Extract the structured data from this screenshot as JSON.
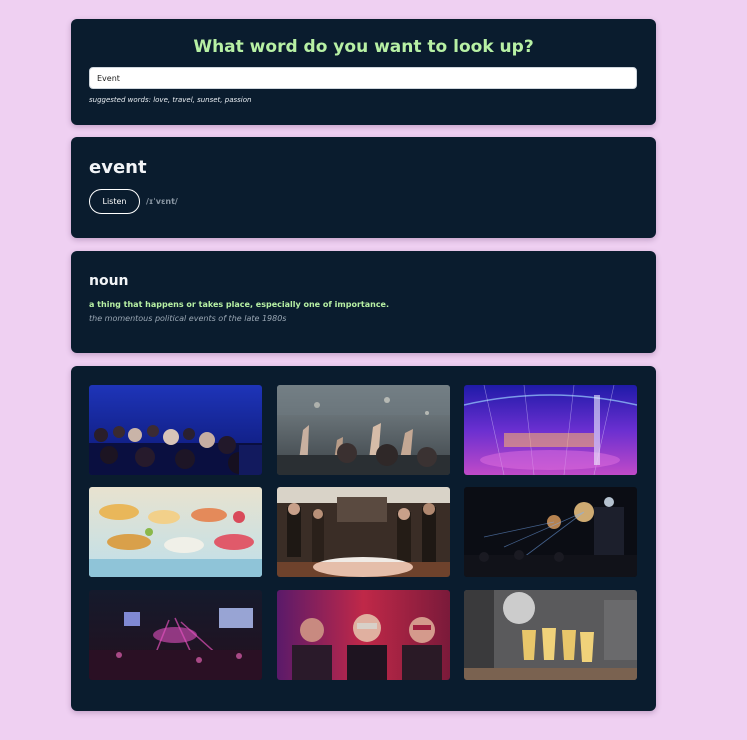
{
  "search": {
    "title": "What word do you want to look up?",
    "value": "Event",
    "suggestions": "suggested words: love, travel, sunset, passion"
  },
  "word": {
    "title": "event",
    "listen_label": "Listen",
    "phonetic": "/ɪˈvɛnt/"
  },
  "meaning": {
    "part_of_speech": "noun",
    "definition": "a thing that happens or takes place, especially one of importance.",
    "example": "the momentous political events of the late 1980s"
  },
  "gallery": {
    "photos": [
      "audience-theater-photo",
      "concert-crowd-photo",
      "purple-stage-photo",
      "buffet-table-photo",
      "party-room-photo",
      "night-concert-photo",
      "pink-concert-photo",
      "masquerade-party-photo",
      "champagne-glasses-photo"
    ]
  },
  "colors": {
    "background": "#efd0f2",
    "card": "#0a1c2e",
    "accent": "#b7f0a4"
  }
}
